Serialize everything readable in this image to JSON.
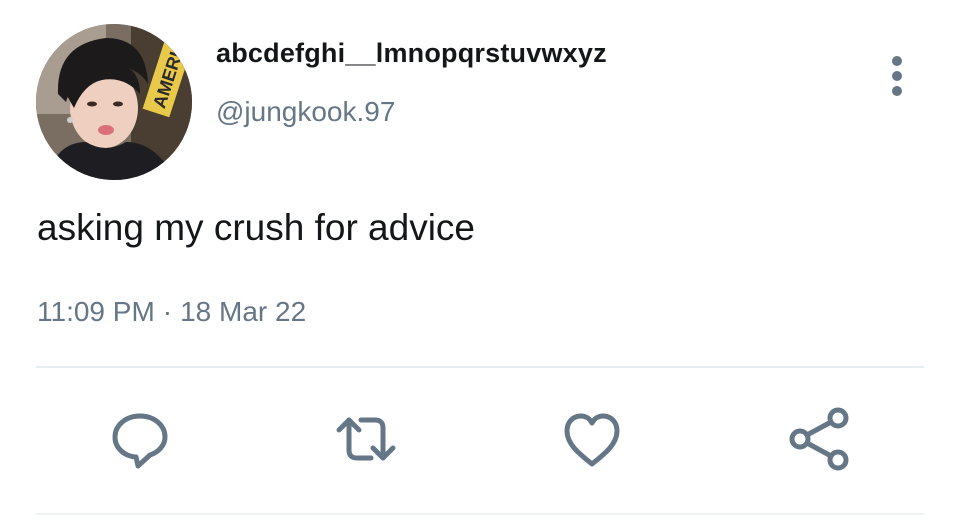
{
  "tweet": {
    "display_name": "abcdefghi__lmnopqrstuvwxyz",
    "handle": "@jungkook.97",
    "text": "asking my crush for advice",
    "time": "11:09 PM",
    "separator": "·",
    "date": "18 Mar 22"
  },
  "avatar": {
    "sign_text": "AMERI"
  },
  "actions": {
    "reply_icon": "speech-bubble-icon",
    "retweet_icon": "retweet-arrows-icon",
    "like_icon": "heart-outline-icon",
    "share_icon": "share-nodes-icon"
  },
  "colors": {
    "text_primary": "#14171a",
    "text_secondary": "#657786",
    "divider": "#e6ecf0",
    "background": "#ffffff"
  }
}
